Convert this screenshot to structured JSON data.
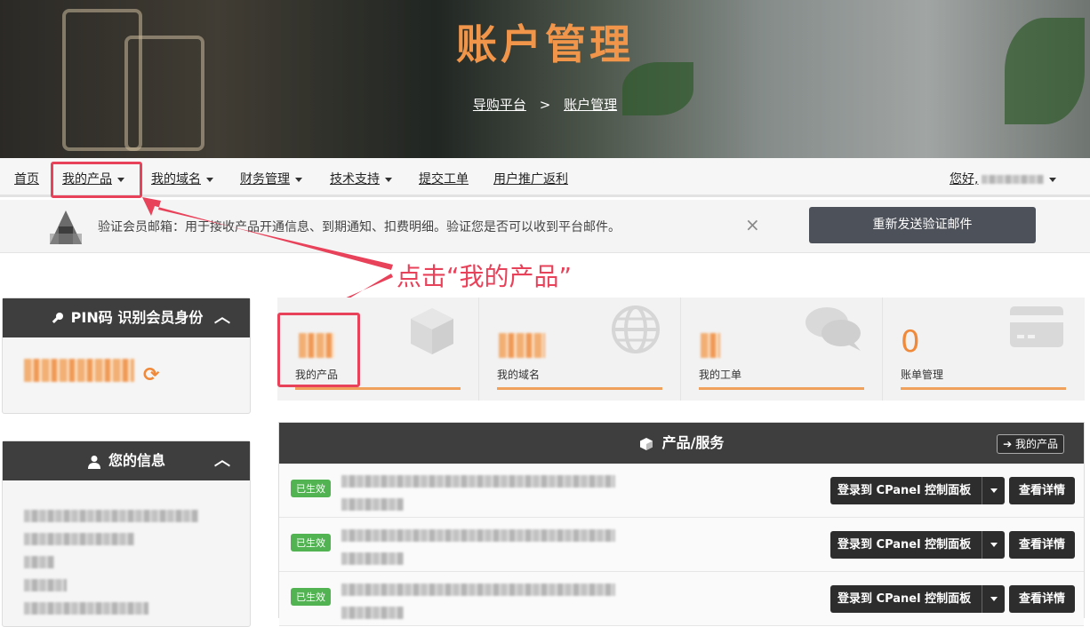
{
  "hero": {
    "title": "账户管理",
    "breadcrumb": [
      "导购平台",
      ">",
      "账户管理"
    ]
  },
  "nav": {
    "items": [
      "首页",
      "我的产品",
      "我的域名",
      "财务管理",
      "技术支持",
      "提交工单",
      "用户推广返利"
    ],
    "greeting": "您好,"
  },
  "notice": {
    "text": "验证会员邮箱：用于接收产品开通信息、到期通知、扣费明细。验证您是否可以收到平台邮件。",
    "close": "×",
    "button": "重新发送验证邮件"
  },
  "annotation": "点击“我的产品”",
  "pin_panel": {
    "title": "PIN码 识别会员身份"
  },
  "info_panel": {
    "title": "您的信息"
  },
  "stats": [
    {
      "label": "我的产品",
      "value": "",
      "icon": "box-icon"
    },
    {
      "label": "我的域名",
      "value": "",
      "icon": "globe-icon"
    },
    {
      "label": "我的工单",
      "value": "",
      "icon": "chat-icon"
    },
    {
      "label": "账单管理",
      "value": "0",
      "icon": "credit-card-icon"
    }
  ],
  "services": {
    "title": "产品/服务",
    "my_products_btn": "我的产品",
    "rows": [
      {
        "status": "已生效",
        "login": "登录到 CPanel 控制面板",
        "detail": "查看详情"
      },
      {
        "status": "已生效",
        "login": "登录到 CPanel 控制面板",
        "detail": "查看详情"
      },
      {
        "status": "已生效",
        "login": "登录到 CPanel 控制面板",
        "detail": "查看详情"
      }
    ]
  },
  "colors": {
    "accent": "#f08a3a",
    "highlight": "#e8425a",
    "dark": "#3e3e3e",
    "success": "#52b352"
  }
}
